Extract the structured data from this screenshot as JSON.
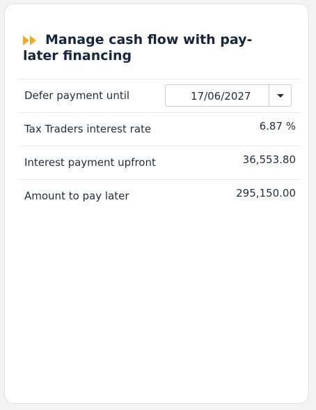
{
  "card": {
    "title": "Manage cash flow with pay-later financing",
    "icon": "fast-forward-icon",
    "accent_color": "#f5a623"
  },
  "rows": [
    {
      "label": "Defer payment until",
      "value": "17/06/2027"
    },
    {
      "label": "Tax Traders interest rate",
      "value": "6.87 %"
    },
    {
      "label": "Interest payment upfront",
      "value": "36,553.80"
    },
    {
      "label": "Amount to pay later",
      "value": "295,150.00"
    }
  ]
}
